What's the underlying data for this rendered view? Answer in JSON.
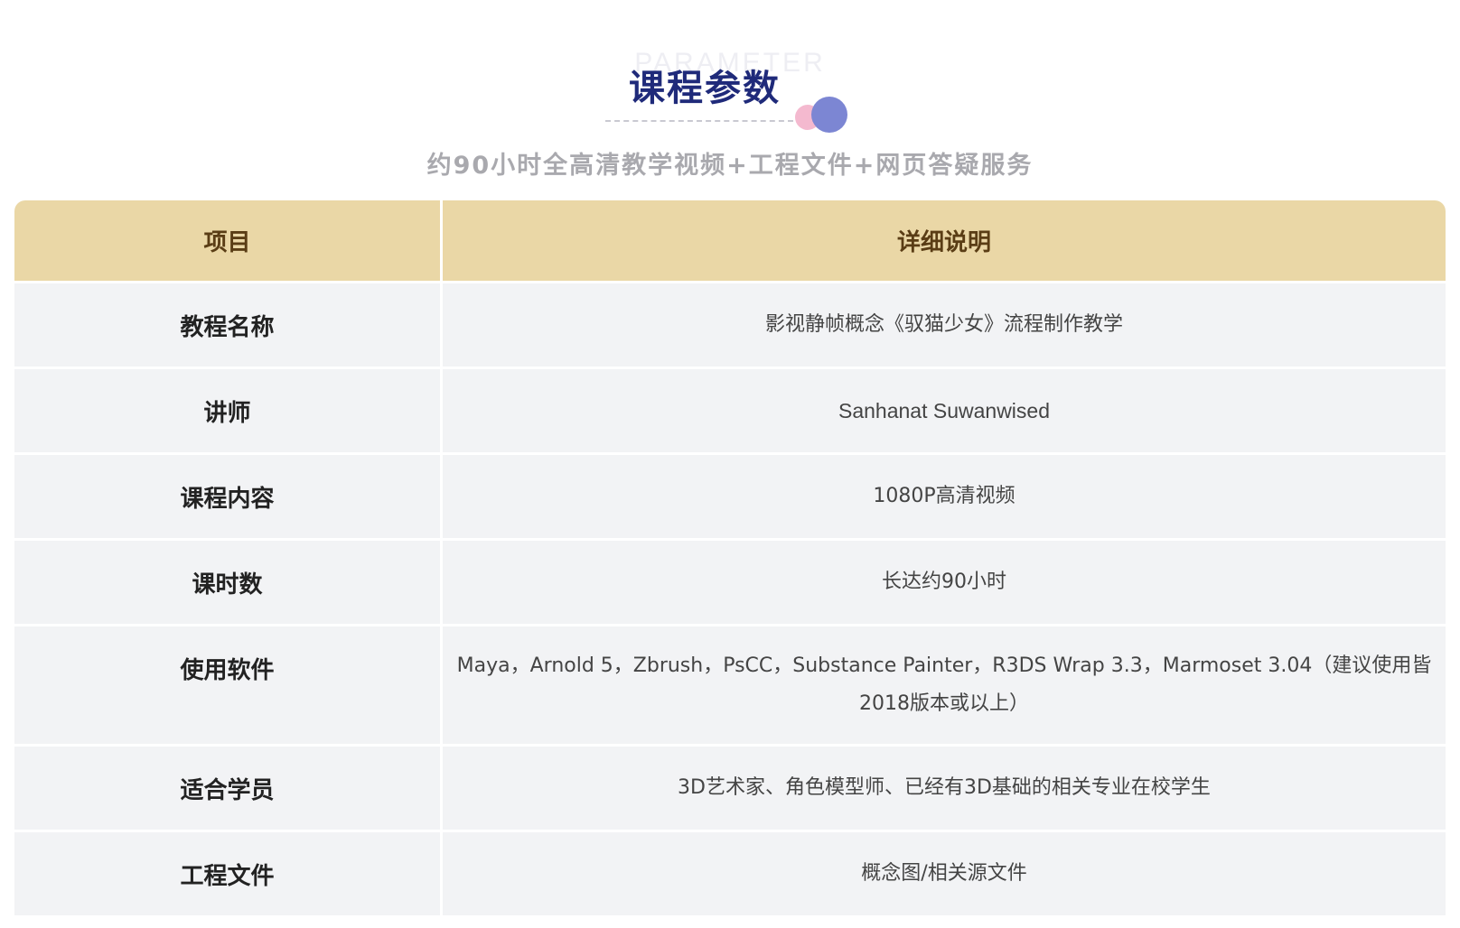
{
  "header": {
    "background_word": "PARAMETER",
    "title": "课程参数",
    "subtitle": "约90小时全高清教学视频+工程文件+网页答疑服务"
  },
  "colors": {
    "title": "#1f2a7a",
    "header_row": "#ead7a6",
    "header_text": "#5a3d15",
    "row_background": "#f2f3f5",
    "dot_pink": "#f4b9cf",
    "dot_blue": "#7c86d3"
  },
  "table": {
    "columns": [
      "项目",
      "详细说明"
    ],
    "rows": [
      {
        "item": "教程名称",
        "detail": "影视静帧概念《驭猫少女》流程制作教学"
      },
      {
        "item": "讲师",
        "detail": "Sanhanat Suwanwised"
      },
      {
        "item": "课程内容",
        "detail": "1080P高清视频"
      },
      {
        "item": "课时数",
        "detail": "长达约90小时"
      },
      {
        "item": "使用软件",
        "detail": "Maya，Arnold 5，Zbrush，PsCC，Substance Painter，R3DS Wrap 3.3，Marmoset 3.04（建议使用皆2018版本或以上）"
      },
      {
        "item": "适合学员",
        "detail": "3D艺术家、角色模型师、已经有3D基础的相关专业在校学生"
      },
      {
        "item": "工程文件",
        "detail": "概念图/相关源文件"
      }
    ]
  }
}
